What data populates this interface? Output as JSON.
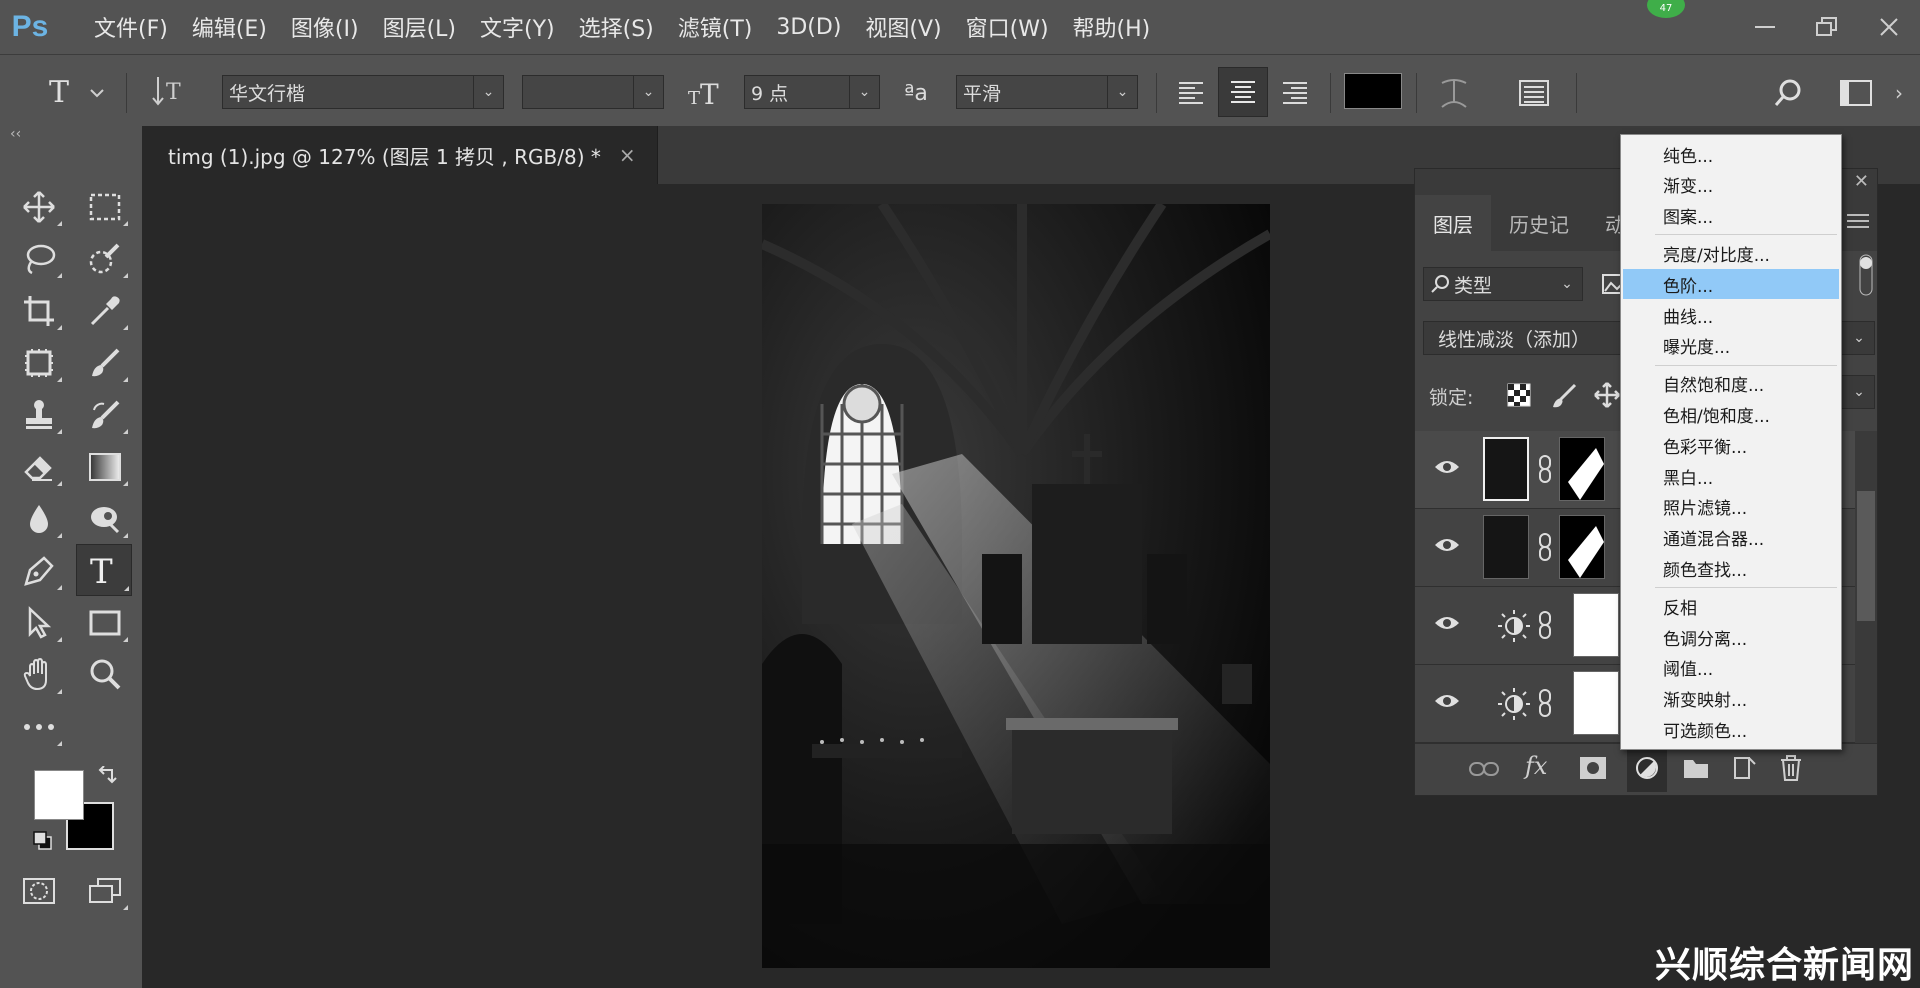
{
  "app": {
    "logo": "Ps"
  },
  "menu": [
    "文件(F)",
    "编辑(E)",
    "图像(I)",
    "图层(L)",
    "文字(Y)",
    "选择(S)",
    "滤镜(T)",
    "3D(D)",
    "视图(V)",
    "窗口(W)",
    "帮助(H)"
  ],
  "notification_badge": "47",
  "options": {
    "font_family": "华文行楷",
    "font_style": "",
    "font_size": "9 点",
    "aa_label": "ªa",
    "antialias": "平滑",
    "text_color": "#000000"
  },
  "document": {
    "tab_title": "timg (1).jpg @ 127% (图层 1 拷贝 , RGB/8) *",
    "close_glyph": "×"
  },
  "layers_panel": {
    "tabs": [
      "图层",
      "历史记",
      "动"
    ],
    "filter_label": "类型",
    "blend_mode": "线性减淡（添加）",
    "lock_label": "锁定:",
    "rows": [
      {
        "kind": "image",
        "visible": true
      },
      {
        "kind": "image",
        "visible": true
      },
      {
        "kind": "adjustment",
        "visible": true
      },
      {
        "kind": "adjustment",
        "visible": true
      }
    ]
  },
  "context_menu": {
    "items": [
      {
        "label": "纯色...",
        "group": 0
      },
      {
        "label": "渐变...",
        "group": 0
      },
      {
        "label": "图案...",
        "group": 0
      },
      {
        "label": "亮度/对比度...",
        "group": 1
      },
      {
        "label": "色阶...",
        "group": 1,
        "highlighted": true
      },
      {
        "label": "曲线...",
        "group": 1
      },
      {
        "label": "曝光度...",
        "group": 1
      },
      {
        "label": "自然饱和度...",
        "group": 2
      },
      {
        "label": "色相/饱和度...",
        "group": 2
      },
      {
        "label": "色彩平衡...",
        "group": 2
      },
      {
        "label": "黑白...",
        "group": 2
      },
      {
        "label": "照片滤镜...",
        "group": 2
      },
      {
        "label": "通道混合器...",
        "group": 2
      },
      {
        "label": "颜色查找...",
        "group": 2
      },
      {
        "label": "反相",
        "group": 3
      },
      {
        "label": "色调分离...",
        "group": 3
      },
      {
        "label": "阈值...",
        "group": 3
      },
      {
        "label": "渐变映射...",
        "group": 3
      },
      {
        "label": "可选颜色...",
        "group": 3
      }
    ]
  },
  "colors": {
    "foreground": "#ffffff",
    "background": "#000000",
    "highlight": "#91c9f7",
    "accent": "#6cb4e4"
  },
  "watermark": "兴顺综合新闻网"
}
